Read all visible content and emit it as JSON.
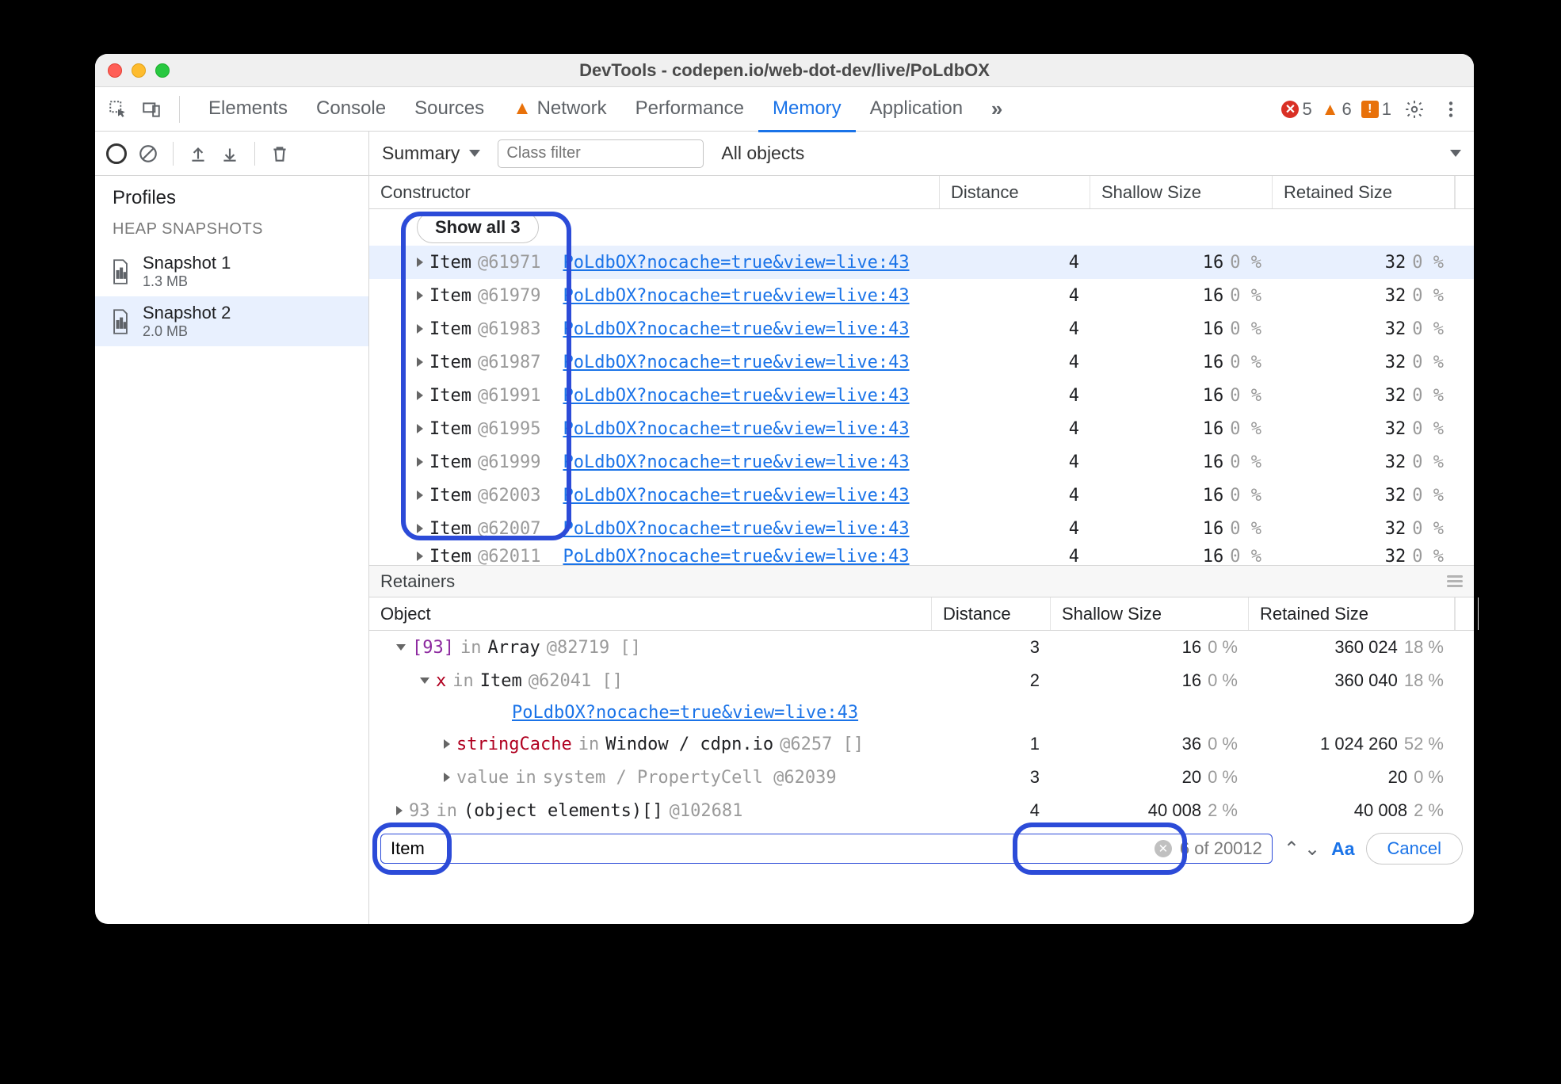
{
  "titlebar": {
    "title": "DevTools - codepen.io/web-dot-dev/live/PoLdbOX"
  },
  "tabs": {
    "items": [
      "Elements",
      "Console",
      "Sources",
      "Network",
      "Performance",
      "Memory",
      "Application"
    ],
    "active": "Memory",
    "network_has_warning": true
  },
  "badges": {
    "errors": "5",
    "warnings": "6",
    "issues": "1"
  },
  "sidebar": {
    "profiles_label": "Profiles",
    "heap_label": "HEAP SNAPSHOTS",
    "snapshots": [
      {
        "name": "Snapshot 1",
        "size": "1.3 MB"
      },
      {
        "name": "Snapshot 2",
        "size": "2.0 MB"
      }
    ]
  },
  "toolbar": {
    "summary_label": "Summary",
    "class_filter_placeholder": "Class filter",
    "all_objects_label": "All objects"
  },
  "grid": {
    "headers": {
      "constructor": "Constructor",
      "distance": "Distance",
      "shallow": "Shallow Size",
      "retained": "Retained Size"
    },
    "showall_label": "Show all 3",
    "link_text": "PoLdbOX?nocache=true&view=live:43",
    "rows": [
      {
        "item": "Item",
        "id": "@61971",
        "distance": "4",
        "shallow": "16",
        "shallow_pct": "0 %",
        "retained": "32",
        "retained_pct": "0 %",
        "selected": true
      },
      {
        "item": "Item",
        "id": "@61979",
        "distance": "4",
        "shallow": "16",
        "shallow_pct": "0 %",
        "retained": "32",
        "retained_pct": "0 %"
      },
      {
        "item": "Item",
        "id": "@61983",
        "distance": "4",
        "shallow": "16",
        "shallow_pct": "0 %",
        "retained": "32",
        "retained_pct": "0 %"
      },
      {
        "item": "Item",
        "id": "@61987",
        "distance": "4",
        "shallow": "16",
        "shallow_pct": "0 %",
        "retained": "32",
        "retained_pct": "0 %"
      },
      {
        "item": "Item",
        "id": "@61991",
        "distance": "4",
        "shallow": "16",
        "shallow_pct": "0 %",
        "retained": "32",
        "retained_pct": "0 %"
      },
      {
        "item": "Item",
        "id": "@61995",
        "distance": "4",
        "shallow": "16",
        "shallow_pct": "0 %",
        "retained": "32",
        "retained_pct": "0 %"
      },
      {
        "item": "Item",
        "id": "@61999",
        "distance": "4",
        "shallow": "16",
        "shallow_pct": "0 %",
        "retained": "32",
        "retained_pct": "0 %"
      },
      {
        "item": "Item",
        "id": "@62003",
        "distance": "4",
        "shallow": "16",
        "shallow_pct": "0 %",
        "retained": "32",
        "retained_pct": "0 %"
      },
      {
        "item": "Item",
        "id": "@62007",
        "distance": "4",
        "shallow": "16",
        "shallow_pct": "0 %",
        "retained": "32",
        "retained_pct": "0 %"
      },
      {
        "item": "Item",
        "id": "@62011",
        "distance": "4",
        "shallow": "16",
        "shallow_pct": "0 %",
        "retained": "32",
        "retained_pct": "0 %"
      }
    ]
  },
  "retainers": {
    "title": "Retainers",
    "headers": {
      "object": "Object",
      "distance": "Distance",
      "shallow": "Shallow Size",
      "retained": "Retained Size"
    },
    "link_text": "PoLdbOX?nocache=true&view=live:43",
    "rows": [
      {
        "depth": 1,
        "caret": "down",
        "label_html": "<span class='idx'>[93]</span> <span class='kw-in'>in</span> <span class='arr'>Array</span> <span class='grey'>@82719 []</span>",
        "distance": "3",
        "shallow": "16",
        "shallow_pct": "0 %",
        "retained": "360 024",
        "retained_pct": "18 %"
      },
      {
        "depth": 2,
        "caret": "down",
        "label_html": "<span class='prop'>x</span> <span class='kw-in'>in</span> <span class='arr'>Item</span> <span class='grey'>@62041 []</span>",
        "distance": "2",
        "shallow": "16",
        "shallow_pct": "0 %",
        "retained": "360 040",
        "retained_pct": "18 %"
      },
      {
        "is_link_line": true
      },
      {
        "depth": 3,
        "caret": "right",
        "label_html": "<span class='prop'>stringCache</span> <span class='kw-in'>in</span> <span class='arr'>Window / cdpn.io</span> <span class='grey'>@6257 []</span>",
        "distance": "1",
        "shallow": "36",
        "shallow_pct": "0 %",
        "retained": "1 024 260",
        "retained_pct": "52 %"
      },
      {
        "depth": 3,
        "caret": "right",
        "label_html": "<span class='grey'>value</span> <span class='grey'>in</span> <span class='grey'>system / PropertyCell @62039</span>",
        "distance": "3",
        "shallow": "20",
        "shallow_pct": "0 %",
        "retained": "20",
        "retained_pct": "0 %"
      },
      {
        "depth": 1,
        "caret": "right",
        "label_html": "<span class='grey'>93</span> <span class='kw-in'>in</span> <span class='arr'>(object elements)[]</span> <span class='grey'>@102681</span>",
        "distance": "4",
        "shallow": "40 008",
        "shallow_pct": "2 %",
        "retained": "40 008",
        "retained_pct": "2 %"
      }
    ]
  },
  "search": {
    "value": "Item",
    "count": "6 of 20012",
    "match_case": "Aa",
    "cancel": "Cancel"
  }
}
